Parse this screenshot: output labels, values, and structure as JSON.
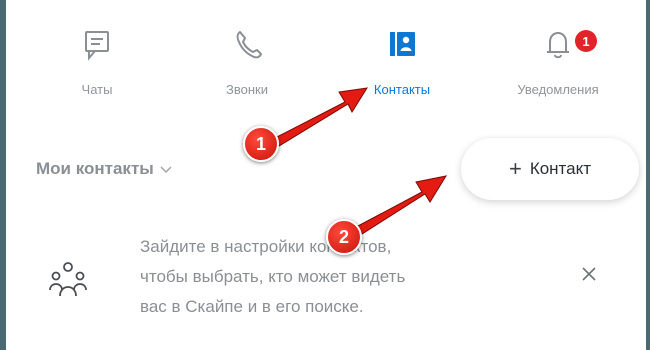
{
  "tabs": [
    {
      "label": "Чаты",
      "icon": "chat-icon",
      "active": false
    },
    {
      "label": "Звонки",
      "icon": "phone-icon",
      "active": false
    },
    {
      "label": "Контакты",
      "icon": "contacts-icon",
      "active": true
    },
    {
      "label": "Уведомления",
      "icon": "bell-icon",
      "active": false,
      "badge": "1"
    }
  ],
  "contacts": {
    "section_title": "Мои контакты",
    "add_button_label": "Контакт"
  },
  "hint": {
    "line1": "Зайдите в настройки контактов,",
    "line2": "чтобы выбрать, кто может видеть",
    "line3": "вас в Скайпе и в его поиске."
  },
  "annotations": {
    "step1": "1",
    "step2": "2"
  },
  "colors": {
    "accent": "#0d78d4",
    "badge": "#e0242a",
    "muted": "#8a8f94",
    "arrow": "#e31b12",
    "frame": "#4a6a73"
  }
}
